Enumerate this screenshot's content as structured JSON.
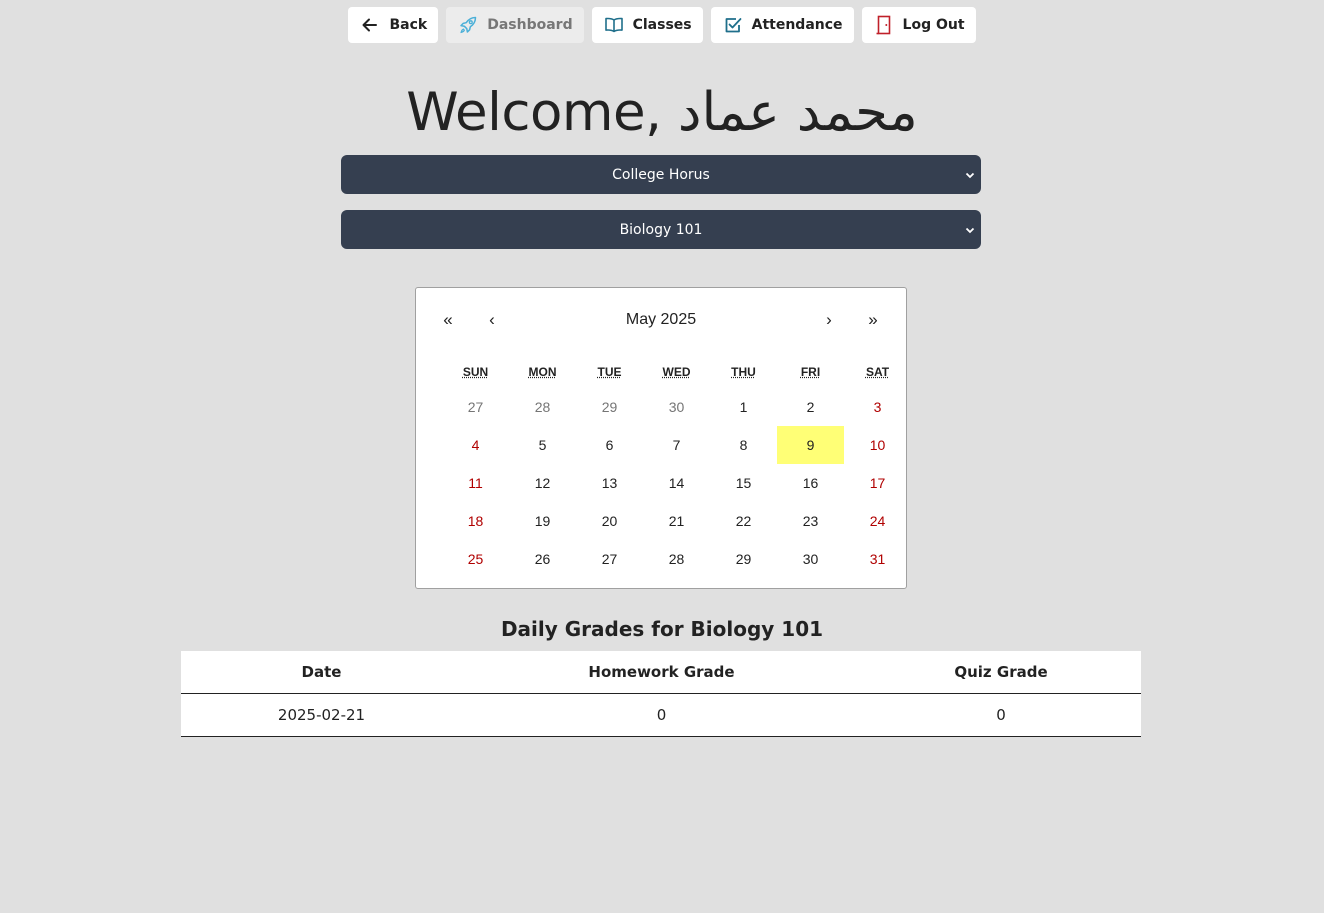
{
  "nav": {
    "back": "Back",
    "dashboard": "Dashboard",
    "classes": "Classes",
    "attendance": "Attendance",
    "logout": "Log Out"
  },
  "welcome": "Welcome, محمد عماد",
  "selects": {
    "college": "College Horus",
    "class": "Biology 101"
  },
  "calendar": {
    "month_label": "May 2025",
    "prev_year": "«",
    "prev_month": "‹",
    "next_month": "›",
    "next_year": "»",
    "weekdays": [
      "SUN",
      "MON",
      "TUE",
      "WED",
      "THU",
      "FRI",
      "SAT"
    ],
    "highlight_color": "#ffff76",
    "weekend_color": "#b00000",
    "days": [
      {
        "n": "27",
        "other": true
      },
      {
        "n": "28",
        "other": true
      },
      {
        "n": "29",
        "other": true
      },
      {
        "n": "30",
        "other": true
      },
      {
        "n": "1"
      },
      {
        "n": "2"
      },
      {
        "n": "3"
      },
      {
        "n": "4"
      },
      {
        "n": "5"
      },
      {
        "n": "6"
      },
      {
        "n": "7"
      },
      {
        "n": "8"
      },
      {
        "n": "9",
        "today": true
      },
      {
        "n": "10"
      },
      {
        "n": "11"
      },
      {
        "n": "12"
      },
      {
        "n": "13"
      },
      {
        "n": "14"
      },
      {
        "n": "15"
      },
      {
        "n": "16"
      },
      {
        "n": "17"
      },
      {
        "n": "18"
      },
      {
        "n": "19"
      },
      {
        "n": "20"
      },
      {
        "n": "21"
      },
      {
        "n": "22"
      },
      {
        "n": "23"
      },
      {
        "n": "24"
      },
      {
        "n": "25"
      },
      {
        "n": "26"
      },
      {
        "n": "27"
      },
      {
        "n": "28"
      },
      {
        "n": "29"
      },
      {
        "n": "30"
      },
      {
        "n": "31"
      }
    ]
  },
  "grades": {
    "title": "Daily Grades for Biology 101",
    "headers": [
      "Date",
      "Homework Grade",
      "Quiz Grade"
    ],
    "rows": [
      [
        "2025-02-21",
        "0",
        "0"
      ]
    ]
  }
}
